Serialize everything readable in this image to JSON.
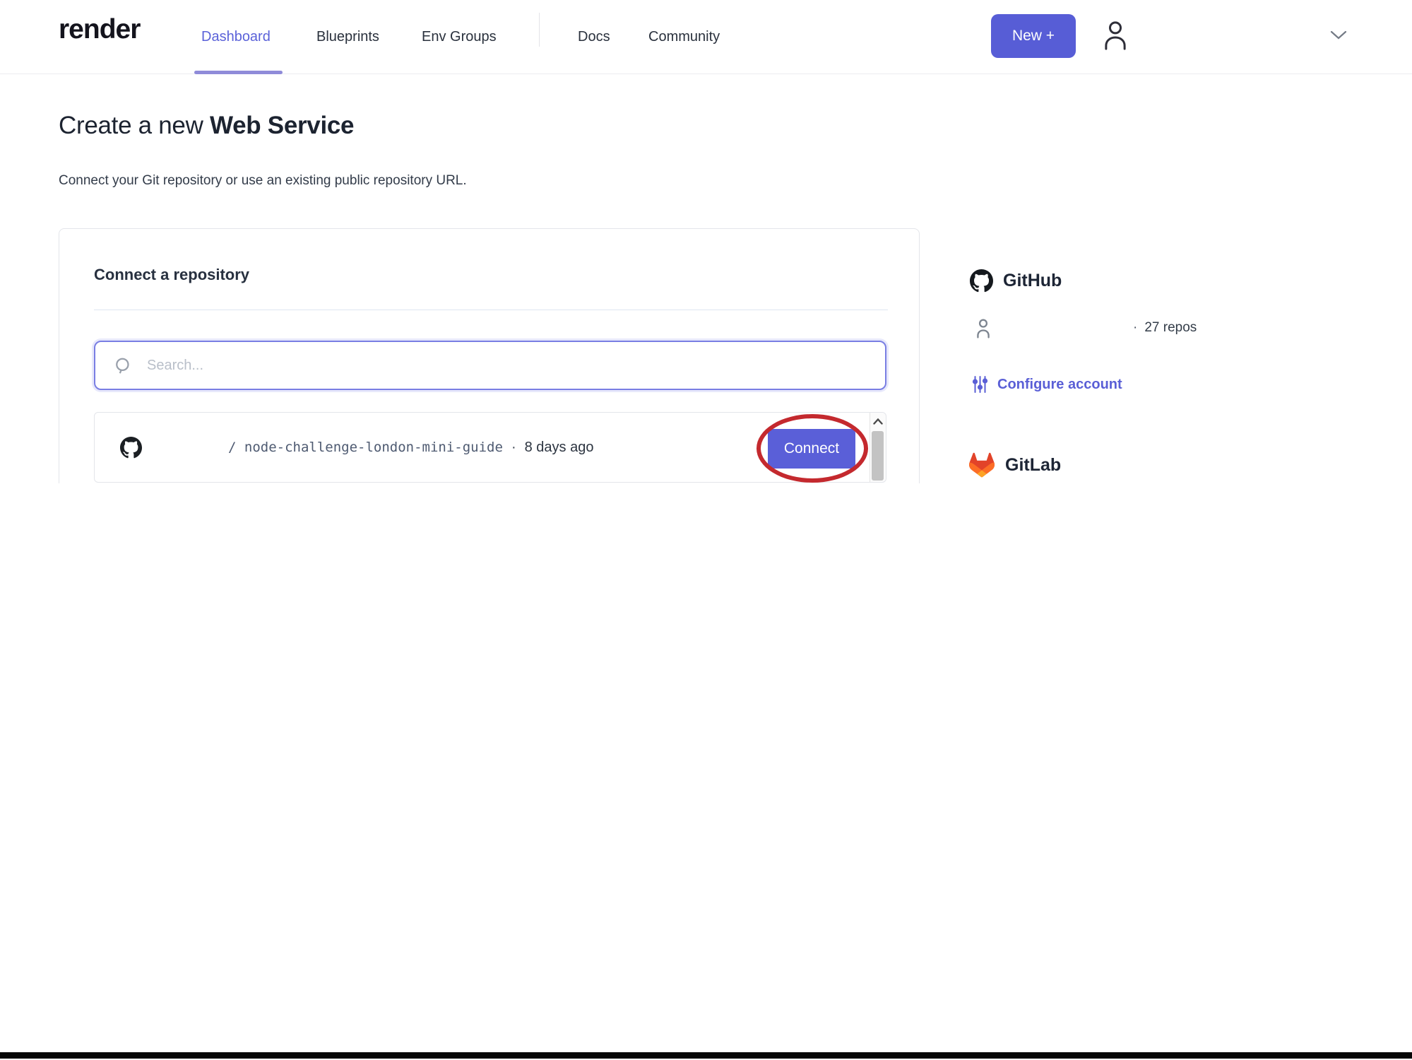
{
  "nav": {
    "logo": "render",
    "items": [
      {
        "label": "Dashboard",
        "active": true
      },
      {
        "label": "Blueprints",
        "active": false
      },
      {
        "label": "Env Groups",
        "active": false
      },
      {
        "label": "Docs",
        "active": false
      },
      {
        "label": "Community",
        "active": false
      }
    ],
    "new_button_label": "New +"
  },
  "page": {
    "title_regular": "Create a new ",
    "title_bold": "Web Service",
    "subtitle": "Connect your Git repository or use an existing public repository URL."
  },
  "card": {
    "title": "Connect a repository",
    "search_placeholder": "Search...",
    "repo": {
      "path": "/ node-challenge-london-mini-guide",
      "separator": "·",
      "updated": "8 days ago",
      "connect_label": "Connect"
    }
  },
  "sidebar": {
    "github": {
      "title": "GitHub",
      "separator": "·",
      "repo_count": "27 repos",
      "configure_label": "Configure account"
    },
    "gitlab": {
      "title": "GitLab"
    }
  },
  "colors": {
    "accent_purple": "#575dd6",
    "link_purple": "#5a5fd6",
    "annotation_red": "#c4292e",
    "gitlab_orange": "#e24329"
  }
}
